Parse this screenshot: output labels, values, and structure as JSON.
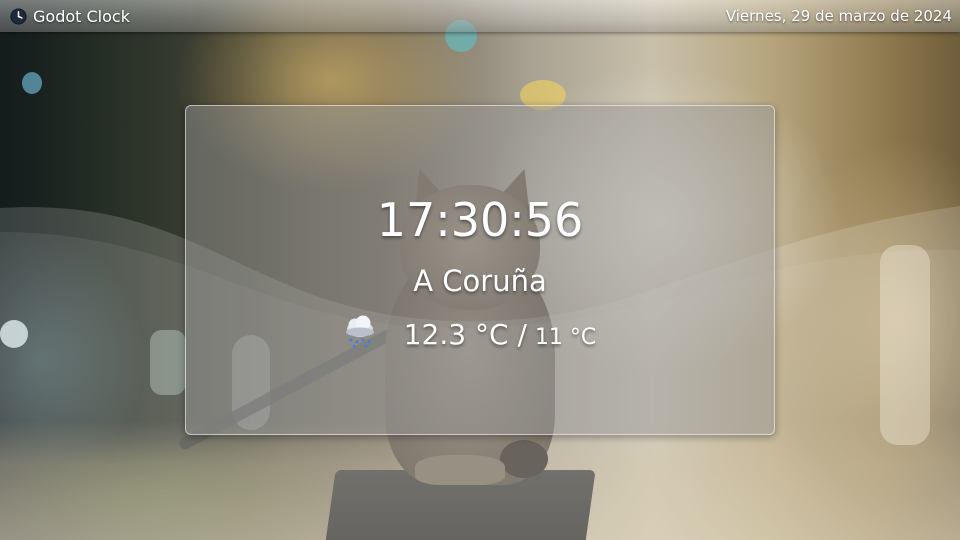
{
  "window": {
    "title": "Godot Clock",
    "date": "Viernes, 29 de marzo de 2024"
  },
  "icons": {
    "app": "clock-icon",
    "weather": "rain-cloud-icon"
  },
  "clock": {
    "time": "17:30:56",
    "city": "A Coruña"
  },
  "weather": {
    "temperature": "12.3 °C",
    "separator": "/",
    "secondary_temperature": "11 °C"
  },
  "colors": {
    "text": "#ffffff",
    "panel": "#969696",
    "panel_border": "#ffffff"
  }
}
